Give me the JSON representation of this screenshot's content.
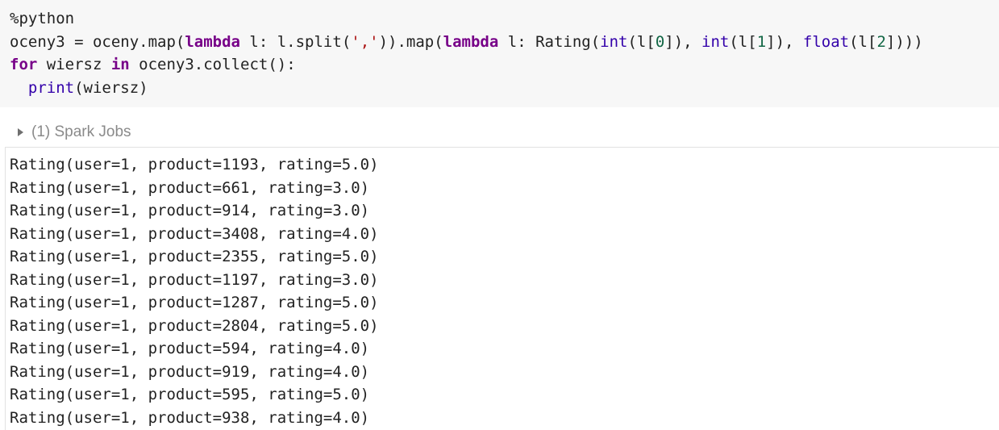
{
  "code_cell": {
    "lines": [
      [
        {
          "t": "%python",
          "c": ""
        }
      ],
      [
        {
          "t": "oceny3 = oceny.map(",
          "c": ""
        },
        {
          "t": "lambda",
          "c": "kw"
        },
        {
          "t": " l: l.split(",
          "c": ""
        },
        {
          "t": "','",
          "c": "st"
        },
        {
          "t": ")).map(",
          "c": ""
        },
        {
          "t": "lambda",
          "c": "kw"
        },
        {
          "t": " l: Rating(",
          "c": ""
        },
        {
          "t": "int",
          "c": "bi"
        },
        {
          "t": "(l[",
          "c": ""
        },
        {
          "t": "0",
          "c": "nu"
        },
        {
          "t": "]), ",
          "c": ""
        },
        {
          "t": "int",
          "c": "bi"
        },
        {
          "t": "(l[",
          "c": ""
        },
        {
          "t": "1",
          "c": "nu"
        },
        {
          "t": "]), ",
          "c": ""
        },
        {
          "t": "float",
          "c": "bi"
        },
        {
          "t": "(l[",
          "c": ""
        },
        {
          "t": "2",
          "c": "nu"
        },
        {
          "t": "])))",
          "c": ""
        }
      ],
      [
        {
          "t": "for",
          "c": "kw"
        },
        {
          "t": " wiersz ",
          "c": ""
        },
        {
          "t": "in",
          "c": "kw"
        },
        {
          "t": " oceny3.collect():",
          "c": ""
        }
      ],
      [
        {
          "t": "  ",
          "c": ""
        },
        {
          "t": "print",
          "c": "bi"
        },
        {
          "t": "(wiersz)",
          "c": ""
        }
      ]
    ]
  },
  "spark_jobs": {
    "label": "(1) Spark Jobs"
  },
  "output": {
    "lines": [
      "Rating(user=1, product=1193, rating=5.0)",
      "Rating(user=1, product=661, rating=3.0)",
      "Rating(user=1, product=914, rating=3.0)",
      "Rating(user=1, product=3408, rating=4.0)",
      "Rating(user=1, product=2355, rating=5.0)",
      "Rating(user=1, product=1197, rating=3.0)",
      "Rating(user=1, product=1287, rating=5.0)",
      "Rating(user=1, product=2804, rating=5.0)",
      "Rating(user=1, product=594, rating=4.0)",
      "Rating(user=1, product=919, rating=4.0)",
      "Rating(user=1, product=595, rating=5.0)",
      "Rating(user=1, product=938, rating=4.0)"
    ]
  }
}
